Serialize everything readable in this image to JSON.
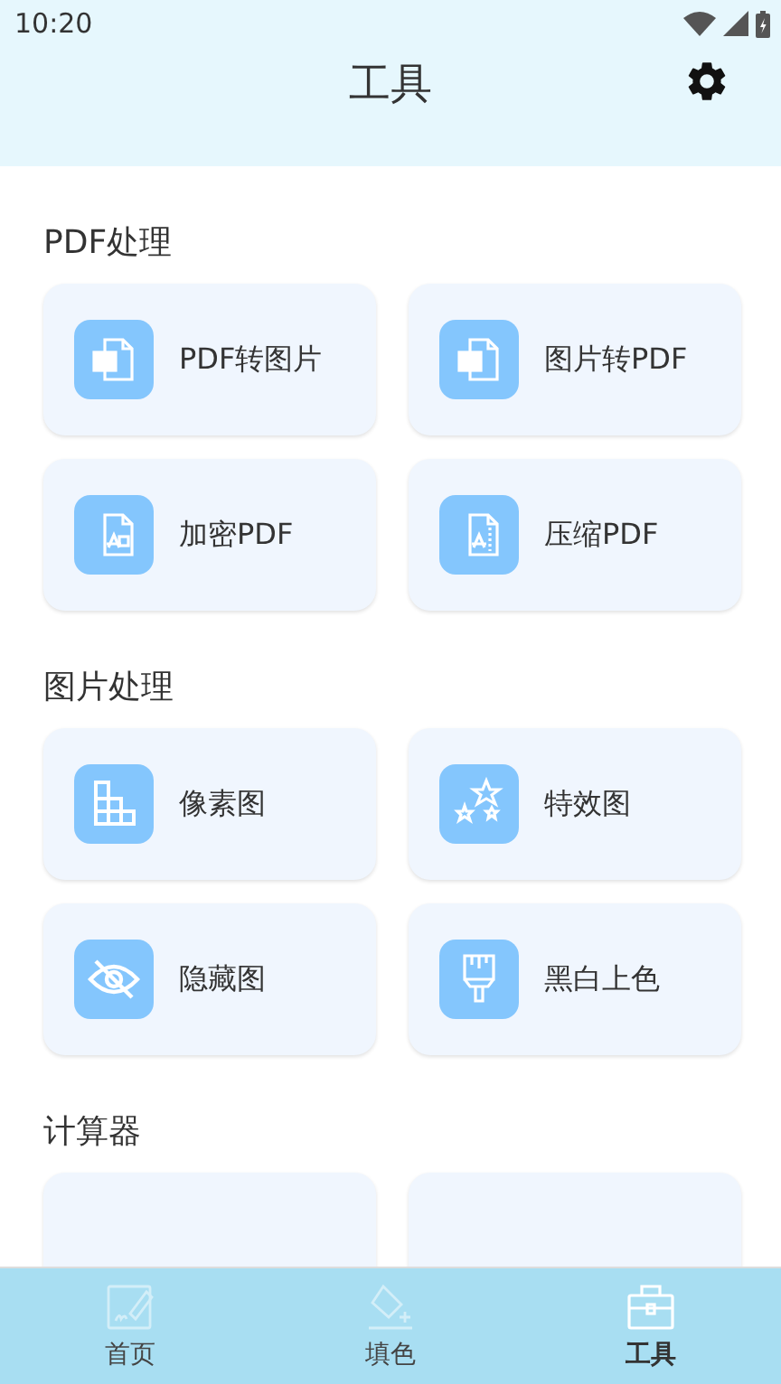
{
  "status_bar": {
    "time": "10:20"
  },
  "header": {
    "title": "工具"
  },
  "sections": [
    {
      "title": "PDF处理",
      "items": [
        {
          "label": "PDF转图片"
        },
        {
          "label": "图片转PDF"
        },
        {
          "label": "加密PDF"
        },
        {
          "label": "压缩PDF"
        }
      ]
    },
    {
      "title": "图片处理",
      "items": [
        {
          "label": "像素图"
        },
        {
          "label": "特效图"
        },
        {
          "label": "隐藏图"
        },
        {
          "label": "黑白上色"
        }
      ]
    },
    {
      "title": "计算器"
    }
  ],
  "tabs": [
    {
      "label": "首页",
      "selected": false
    },
    {
      "label": "填色",
      "selected": false
    },
    {
      "label": "工具",
      "selected": true
    }
  ]
}
